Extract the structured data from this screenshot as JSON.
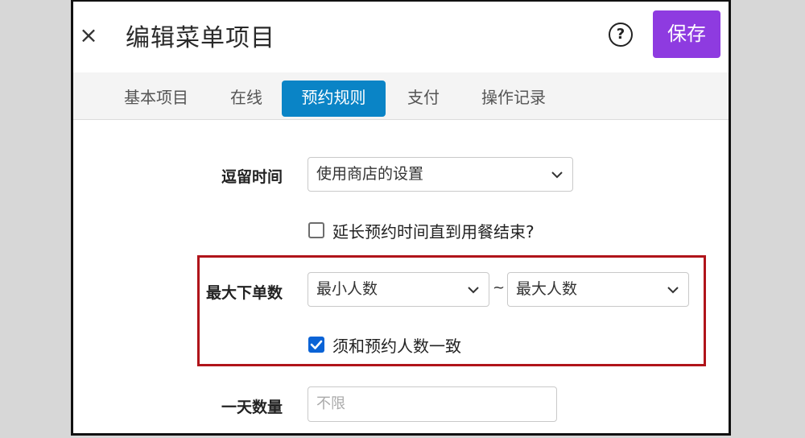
{
  "header": {
    "close_icon": "×",
    "title": "编辑菜单项目",
    "help_icon": "?",
    "save_label": "保存",
    "save_color": "#8e3be0"
  },
  "tabs": [
    {
      "label": "基本项目",
      "active": false
    },
    {
      "label": "在线",
      "active": false
    },
    {
      "label": "预约规则",
      "active": true
    },
    {
      "label": "支付",
      "active": false
    },
    {
      "label": "操作记录",
      "active": false
    }
  ],
  "form": {
    "stay_time": {
      "label": "逗留时间",
      "value": "使用商店的设置"
    },
    "extend_checkbox": {
      "label": "延长预约时间直到用餐结束?",
      "checked": false
    },
    "max_orders": {
      "label": "最大下单数",
      "min_value": "最小人数",
      "separator": "~",
      "max_value": "最大人数"
    },
    "match_checkbox": {
      "label": "须和预约人数一致",
      "checked": true
    },
    "daily_count": {
      "label": "一天数量",
      "placeholder": "不限"
    }
  },
  "colors": {
    "active_tab": "#0a84c6",
    "highlight_border": "#b0141a",
    "checkbox_checked": "#0a63d6"
  }
}
